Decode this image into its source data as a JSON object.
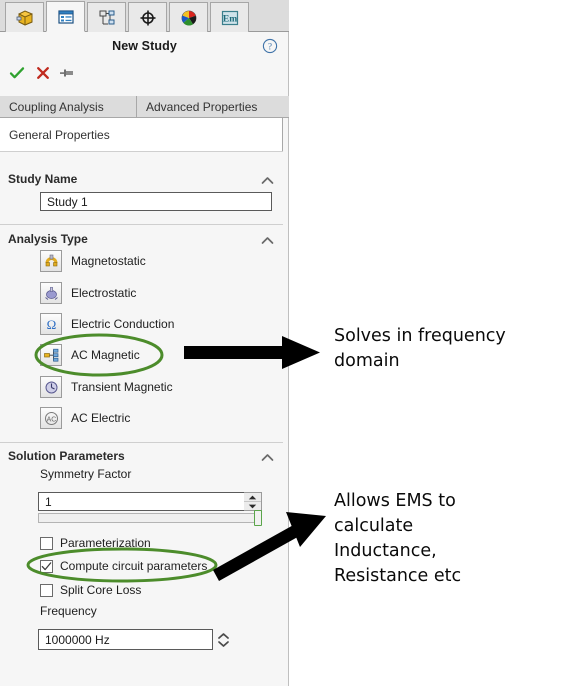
{
  "panel": {
    "title": "New Study",
    "icon_tabs": [
      {
        "name": "feature-manager-tree-icon",
        "label": "FeatureManager design tree"
      },
      {
        "name": "property-manager-icon",
        "label": "PropertyManager"
      },
      {
        "name": "configuration-manager-icon",
        "label": "ConfigurationManager"
      },
      {
        "name": "dimxpert-manager-icon",
        "label": "DimXpertManager"
      },
      {
        "name": "display-manager-icon",
        "label": "DisplayManager"
      },
      {
        "name": "ems-manager-icon",
        "label": "Em"
      }
    ],
    "actions": {
      "ok_label": "OK",
      "cancel_label": "Cancel",
      "pin_label": "Keep Visible",
      "help_label": "Help"
    },
    "tabs": [
      {
        "label": "Coupling Analysis",
        "selected": false
      },
      {
        "label": "Advanced Properties",
        "selected": false
      }
    ],
    "subtab": {
      "label": "General Properties"
    },
    "sections": {
      "study_name": {
        "header": "Study Name",
        "value": "Study 1"
      },
      "analysis_type": {
        "header": "Analysis Type",
        "options": [
          {
            "label": "Magnetostatic",
            "icon": "magnetostatic-icon",
            "selected": false
          },
          {
            "label": "Electrostatic",
            "icon": "electrostatic-icon",
            "selected": false
          },
          {
            "label": "Electric Conduction",
            "icon": "electric-conduction-icon",
            "selected": false
          },
          {
            "label": "AC Magnetic",
            "icon": "ac-magnetic-icon",
            "selected": true
          },
          {
            "label": "Transient Magnetic",
            "icon": "transient-magnetic-icon",
            "selected": false
          },
          {
            "label": "AC Electric",
            "icon": "ac-electric-icon",
            "selected": false
          }
        ]
      },
      "solution_parameters": {
        "header": "Solution Parameters",
        "symmetry_factor_label": "Symmetry Factor",
        "symmetry_factor_value": "1",
        "checkboxes": [
          {
            "label": "Parameterization",
            "checked": false
          },
          {
            "label": "Compute circuit parameters",
            "checked": true
          },
          {
            "label": "Split Core Loss",
            "checked": false
          }
        ],
        "frequency_label": "Frequency",
        "frequency_value": "1000000 Hz"
      }
    }
  },
  "annotations": {
    "highlight_color": "#4c8c2b",
    "arrow_color": "#000000",
    "callout_1": "Solves in frequency\ndomain",
    "callout_2": "Allows EMS to\ncalculate\nInductance,\nResistance etc"
  }
}
